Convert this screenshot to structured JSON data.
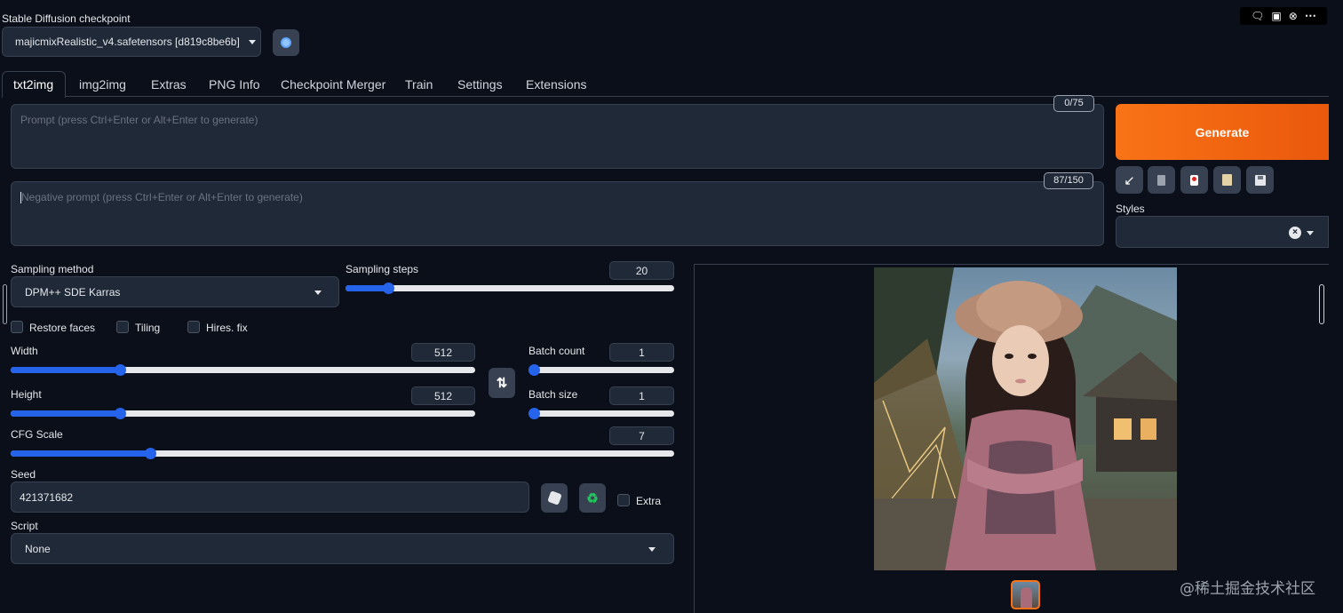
{
  "checkpoint": {
    "label": "Stable Diffusion checkpoint",
    "value": "majicmixRealistic_v4.safetensors [d819c8be6b]"
  },
  "tabs": [
    "txt2img",
    "img2img",
    "Extras",
    "PNG Info",
    "Checkpoint Merger",
    "Train",
    "Settings",
    "Extensions"
  ],
  "active_tab": "txt2img",
  "prompt": {
    "placeholder": "Prompt (press Ctrl+Enter or Alt+Enter to generate)",
    "counter": "0/75"
  },
  "negative_prompt": {
    "placeholder": "Negative prompt (press Ctrl+Enter or Alt+Enter to generate)",
    "counter": "87/150"
  },
  "generate_label": "Generate",
  "styles_label": "Styles",
  "sampling": {
    "method_label": "Sampling method",
    "method_value": "DPM++ SDE Karras",
    "steps_label": "Sampling steps",
    "steps_value": "20",
    "steps_fraction": 0.13
  },
  "checkboxes": {
    "restore_faces": "Restore faces",
    "tiling": "Tiling",
    "hires_fix": "Hires. fix"
  },
  "width": {
    "label": "Width",
    "value": "512",
    "fraction": 0.235
  },
  "height": {
    "label": "Height",
    "value": "512",
    "fraction": 0.235
  },
  "batch_count": {
    "label": "Batch count",
    "value": "1",
    "fraction": 0.0
  },
  "batch_size": {
    "label": "Batch size",
    "value": "1",
    "fraction": 0.0
  },
  "cfg": {
    "label": "CFG Scale",
    "value": "7",
    "fraction": 0.21
  },
  "seed": {
    "label": "Seed",
    "value": "421371682",
    "extra_label": "Extra"
  },
  "script": {
    "label": "Script",
    "value": "None"
  },
  "watermark": "@稀土掘金技术社区",
  "colors": {
    "background": "#0b0f19",
    "panel": "#1f2937",
    "accent_orange": "#f97316",
    "slider_blue": "#2563eb"
  }
}
